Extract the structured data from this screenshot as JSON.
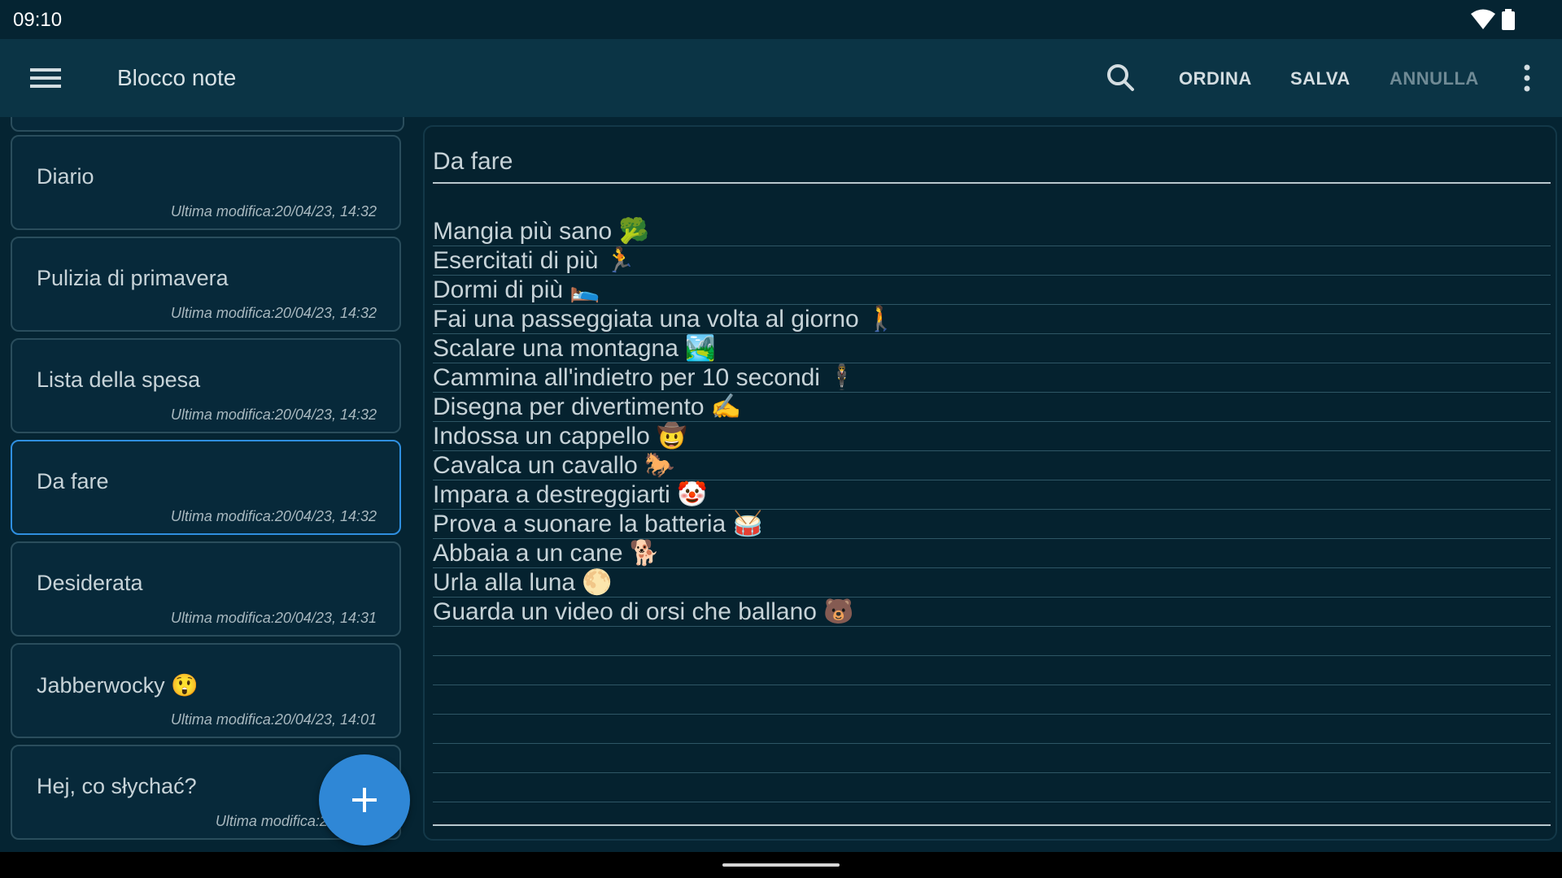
{
  "status_bar": {
    "time": "09:10"
  },
  "app_bar": {
    "title": "Blocco note",
    "actions": {
      "sort": "ORDINA",
      "save": "SALVA",
      "cancel": "ANNULLA"
    },
    "icons": {
      "menu": "hamburger-menu-icon",
      "search": "search-icon",
      "overflow": "more-vert-icon"
    }
  },
  "notes": [
    {
      "title": "Diario",
      "date": "Ultima modifica:20/04/23, 14:32"
    },
    {
      "title": "Pulizia di primavera",
      "date": "Ultima modifica:20/04/23, 14:32"
    },
    {
      "title": "Lista della spesa",
      "date": "Ultima modifica:20/04/23, 14:32"
    },
    {
      "title": "Da fare",
      "date": "Ultima modifica:20/04/23, 14:32",
      "selected": true
    },
    {
      "title": "Desiderata",
      "date": "Ultima modifica:20/04/23, 14:31"
    },
    {
      "title": "Jabberwocky 😲",
      "date": "Ultima modifica:20/04/23, 14:01"
    },
    {
      "title": "Hej, co słychać?",
      "date": "Ultima modifica:20/04/23"
    }
  ],
  "editor": {
    "title": "Da fare",
    "lines": [
      "Mangia più sano 🥦",
      "Esercitati di più 🏃",
      "Dormi di più 🛌",
      "Fai una passeggiata una volta al giorno 🚶",
      "Scalare una montagna 🏞️",
      "Cammina all'indietro per 10 secondi  🕴️",
      "Disegna per divertimento ✍️",
      "Indossa un cappello 🤠",
      "Cavalca un cavallo 🐎",
      "Impara a destreggiarti 🤡",
      "Prova a suonare la batteria 🥁",
      "Abbaia a un cane 🐕",
      "Urla alla luna 🌕",
      "Guarda un video di orsi che ballano 🐻",
      "",
      "",
      "",
      "",
      "",
      ""
    ]
  },
  "fab": {
    "icon": "plus-icon"
  },
  "colors": {
    "background": "#052432",
    "app_bar": "#0b3445",
    "accent": "#2f87d6",
    "selected_border": "#2f8fe0"
  }
}
